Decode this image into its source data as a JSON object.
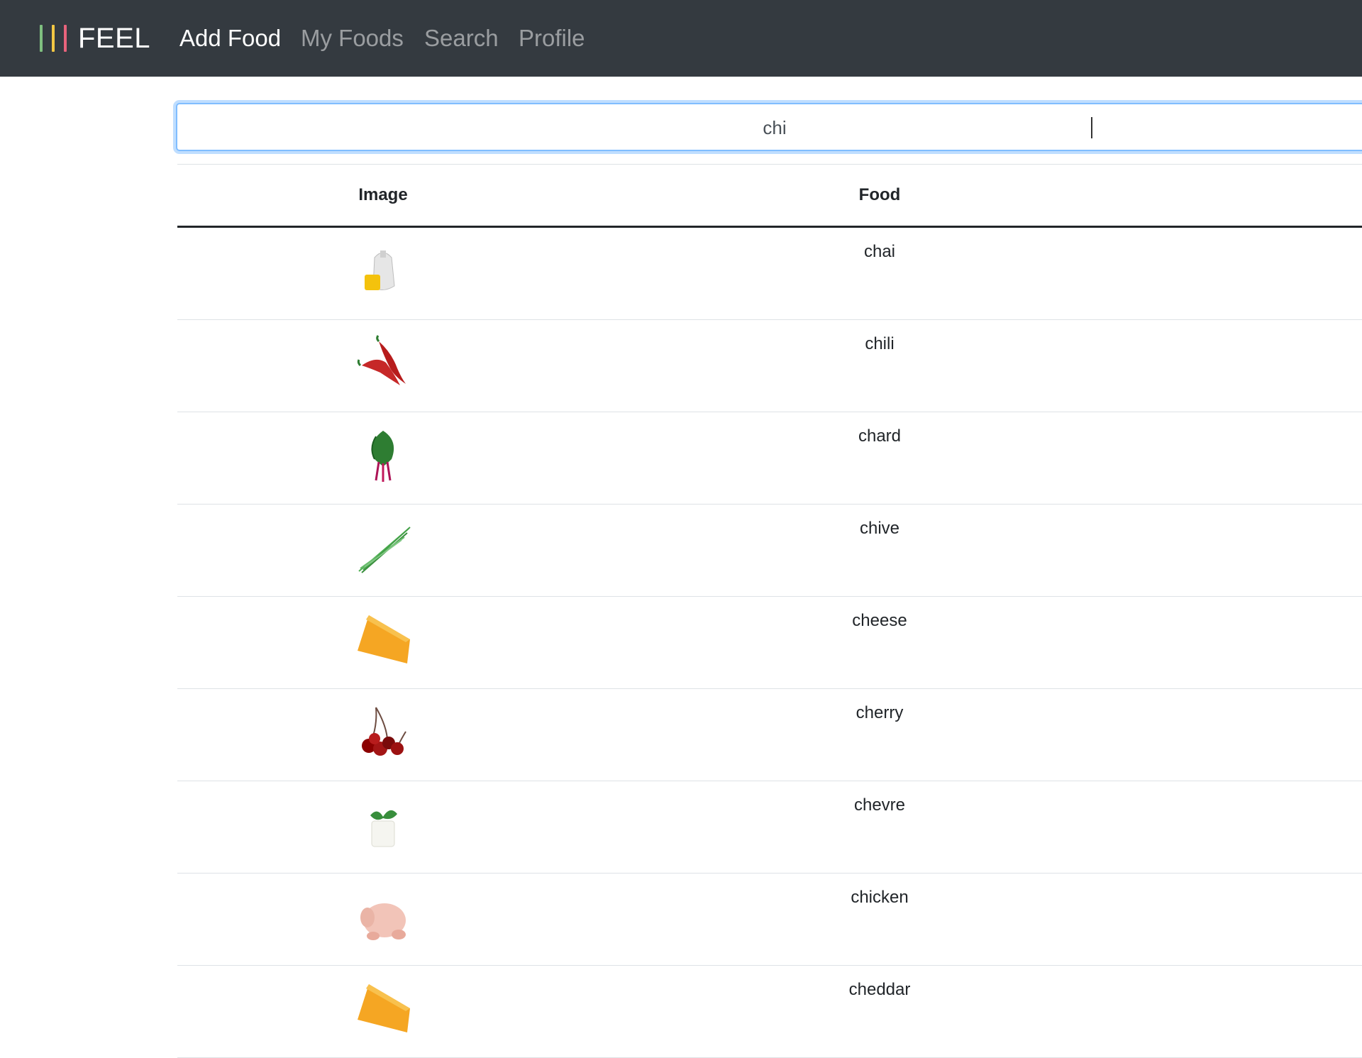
{
  "navbar": {
    "brand": "FEEL",
    "brand_bars": [
      "#7fbf7f",
      "#f2c744",
      "#e8637c"
    ],
    "items": [
      {
        "label": "Add Food",
        "active": true
      },
      {
        "label": "My Foods",
        "active": false
      },
      {
        "label": "Search",
        "active": false
      },
      {
        "label": "Profile",
        "active": false
      }
    ]
  },
  "search": {
    "value": "chi",
    "focus_color": "#80bdff"
  },
  "table": {
    "headers": {
      "image": "Image",
      "food": "Food"
    },
    "rows": [
      {
        "food": "chai",
        "icon": "tea-bag-icon"
      },
      {
        "food": "chili",
        "icon": "chili-pepper-icon"
      },
      {
        "food": "chard",
        "icon": "chard-leaf-icon"
      },
      {
        "food": "chive",
        "icon": "chive-icon"
      },
      {
        "food": "cheese",
        "icon": "cheese-wedge-icon"
      },
      {
        "food": "cherry",
        "icon": "cherries-icon"
      },
      {
        "food": "chevre",
        "icon": "goat-cheese-icon"
      },
      {
        "food": "chicken",
        "icon": "raw-chicken-icon"
      },
      {
        "food": "cheddar",
        "icon": "cheddar-wedge-icon"
      }
    ]
  },
  "colors": {
    "navbar_bg": "#343a40",
    "nav_active": "#ffffff",
    "nav_inactive": "rgba(255,255,255,0.5)"
  }
}
